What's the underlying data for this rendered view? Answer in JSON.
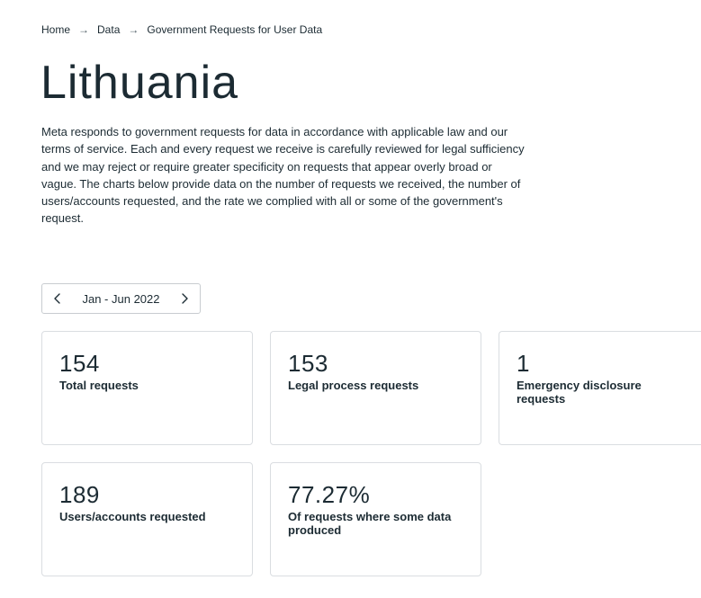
{
  "breadcrumb": {
    "items": [
      "Home",
      "Data",
      "Government Requests for User Data"
    ],
    "separator": "→"
  },
  "title": "Lithuania",
  "description": "Meta responds to government requests for data in accordance with applicable law and our terms of service. Each and every request we receive is carefully reviewed for legal sufficiency and we may reject or require greater specificity on requests that appear overly broad or vague. The charts below provide data on the number of requests we received, the number of users/accounts requested, and the rate we complied with all or some of the government's request.",
  "period_selector": {
    "label": "Jan - Jun 2022",
    "prev_icon": "chevron-left-icon",
    "next_icon": "chevron-right-icon"
  },
  "stats": [
    {
      "value": "154",
      "label": "Total requests"
    },
    {
      "value": "153",
      "label": "Legal process requests"
    },
    {
      "value": "1",
      "label": "Emergency disclosure requests"
    },
    {
      "value": "189",
      "label": "Users/accounts requested"
    },
    {
      "value": "77.27%",
      "label": "Of requests where some data produced"
    }
  ],
  "colors": {
    "text": "#1c2b33",
    "border": "#dadde1"
  }
}
